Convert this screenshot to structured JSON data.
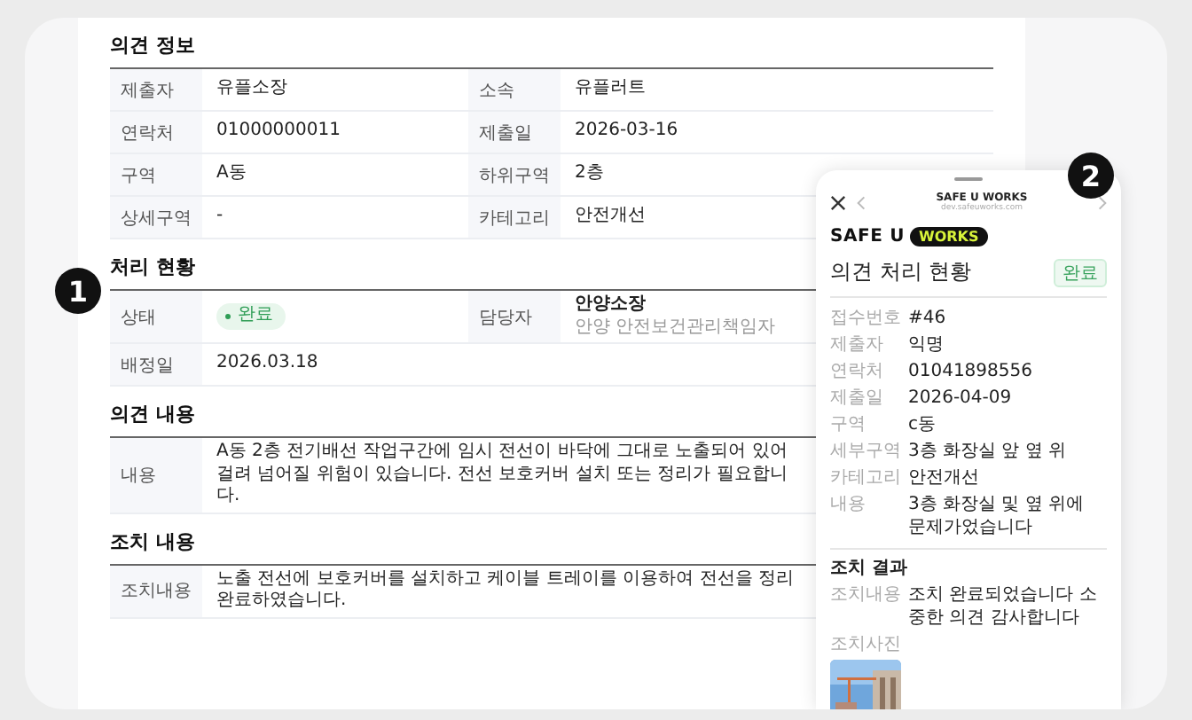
{
  "sections": [
    {
      "title": "의견 정보",
      "rows": [
        [
          {
            "label": "제출자",
            "value": "유플소장"
          },
          {
            "label": "소속",
            "value": "유플러트"
          }
        ],
        [
          {
            "label": "연락처",
            "value": "01000000011"
          },
          {
            "label": "제출일",
            "value": "2026-03-16"
          }
        ],
        [
          {
            "label": "구역",
            "value": "A동"
          },
          {
            "label": "하위구역",
            "value": "2층"
          }
        ],
        [
          {
            "label": "상세구역",
            "value": "-"
          },
          {
            "label": "카테고리",
            "value": "안전개선"
          }
        ]
      ]
    },
    {
      "title": "처리 현황",
      "marker": "1",
      "rows": [
        [
          {
            "label": "상태",
            "kind": "status",
            "value": "완료"
          },
          {
            "label": "담당자",
            "kind": "person",
            "value": "안양소장",
            "note": "안양 안전보건관리책임자"
          }
        ],
        [
          {
            "label": "배정일",
            "value": "2026.03.18"
          }
        ]
      ]
    },
    {
      "title": "의견 내용",
      "rows": [
        [
          {
            "label": "내용",
            "value": "A동 2층 전기배선 작업구간에 임시 전선이 바닥에 그대로 노출되어 있어 걸려 넘어질 위험이 있습니다. 전선 보호커버 설치 또는 정리가 필요합니다."
          }
        ]
      ]
    },
    {
      "title": "조치 내용",
      "rows": [
        [
          {
            "label": "조치내용",
            "value": "노출 전선에 보호커버를 설치하고 케이블 트레이를 이용하여 전선을 정리 완료하였습니다."
          }
        ]
      ]
    }
  ],
  "mobile": {
    "marker": "2",
    "header": {
      "title": "SAFE U WORKS",
      "url": "dev.safeuworks.com"
    },
    "logo": {
      "text": "SAFE U",
      "highlight": "WORKS"
    },
    "title": "의견 처리 현황",
    "status": "완료",
    "fields": [
      {
        "label": "접수번호",
        "value": "#46"
      },
      {
        "label": "제출자",
        "value": "익명"
      },
      {
        "label": "연락처",
        "value": "01041898556"
      },
      {
        "label": "제출일",
        "value": "2026-04-09"
      },
      {
        "label": "구역",
        "value": "c동"
      },
      {
        "label": "세부구역",
        "value": "3층 화장실 앞 옆 위"
      },
      {
        "label": "카테고리",
        "value": "안전개선"
      },
      {
        "label": "내용",
        "value": "3층 화장실 및 옆 위에 문제가었습니다"
      }
    ],
    "result_title": "조치 결과",
    "result_fields": [
      {
        "label": "조치내용",
        "kind": "text",
        "value": "조치 완료되었습니다 소중한 의견 감사합니다"
      },
      {
        "label": "조치사진"
      }
    ]
  }
}
